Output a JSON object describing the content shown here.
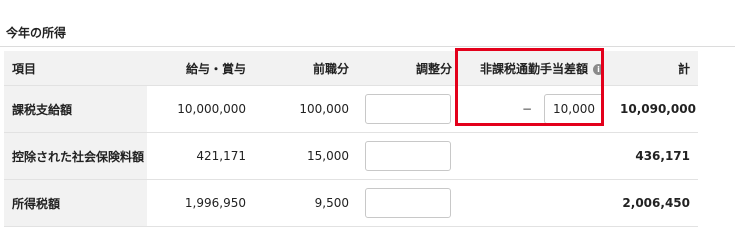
{
  "section": {
    "title": "今年の所得"
  },
  "table": {
    "headers": [
      "項目",
      "給与・賞与",
      "前職分",
      "調整分",
      "非課税通勤手当差額",
      "計"
    ],
    "rows": [
      {
        "label": "課税支給額",
        "salary": "10,000,000",
        "previous_job": "100,000",
        "adjustment": "",
        "nontax_prefix": "−",
        "nontax_value": "10,000",
        "total": "10,090,000"
      },
      {
        "label": "控除された社会保険料額",
        "salary": "421,171",
        "previous_job": "15,000",
        "adjustment": "",
        "total": "436,171"
      },
      {
        "label": "所得税額",
        "salary": "1,996,950",
        "previous_job": "9,500",
        "adjustment": "",
        "total": "2,006,450"
      }
    ]
  },
  "icons": {
    "info": "info-icon"
  },
  "colors": {
    "highlight": "#e3001b",
    "header_bg": "#f2f2f2"
  }
}
